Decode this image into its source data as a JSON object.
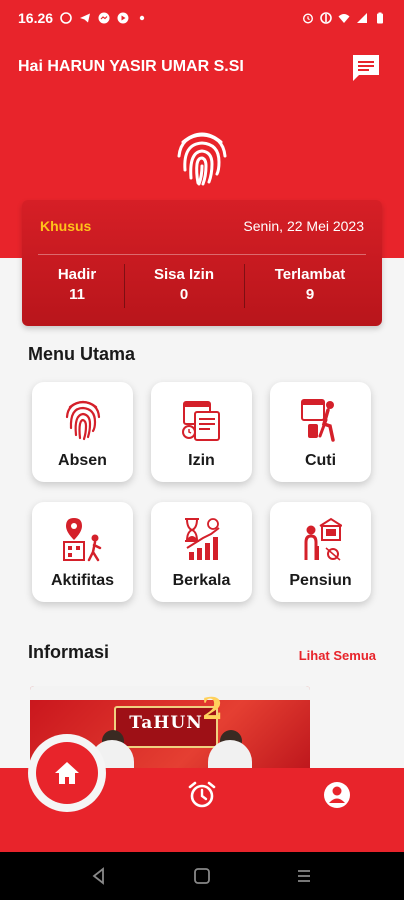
{
  "status_bar": {
    "time": "16.26"
  },
  "header": {
    "greeting": "Hai  HARUN YASIR UMAR S.SI"
  },
  "stats": {
    "type": "Khusus",
    "date": "Senin, 22 Mei 2023",
    "items": [
      {
        "label": "Hadir",
        "value": "11"
      },
      {
        "label": "Sisa Izin",
        "value": "0"
      },
      {
        "label": "Terlambat",
        "value": "9"
      }
    ]
  },
  "menu": {
    "title": "Menu Utama",
    "items": [
      {
        "label": "Absen"
      },
      {
        "label": "Izin"
      },
      {
        "label": "Cuti"
      },
      {
        "label": "Aktifitas"
      },
      {
        "label": "Berkala"
      },
      {
        "label": "Pensiun"
      }
    ]
  },
  "info": {
    "title": "Informasi",
    "see_all": "Lihat Semua",
    "banner_text": "TaHUN",
    "banner_number": "2"
  },
  "colors": {
    "primary": "#e8242b",
    "accent_yellow": "#ffc21a",
    "card_dark": "#b8151b"
  }
}
